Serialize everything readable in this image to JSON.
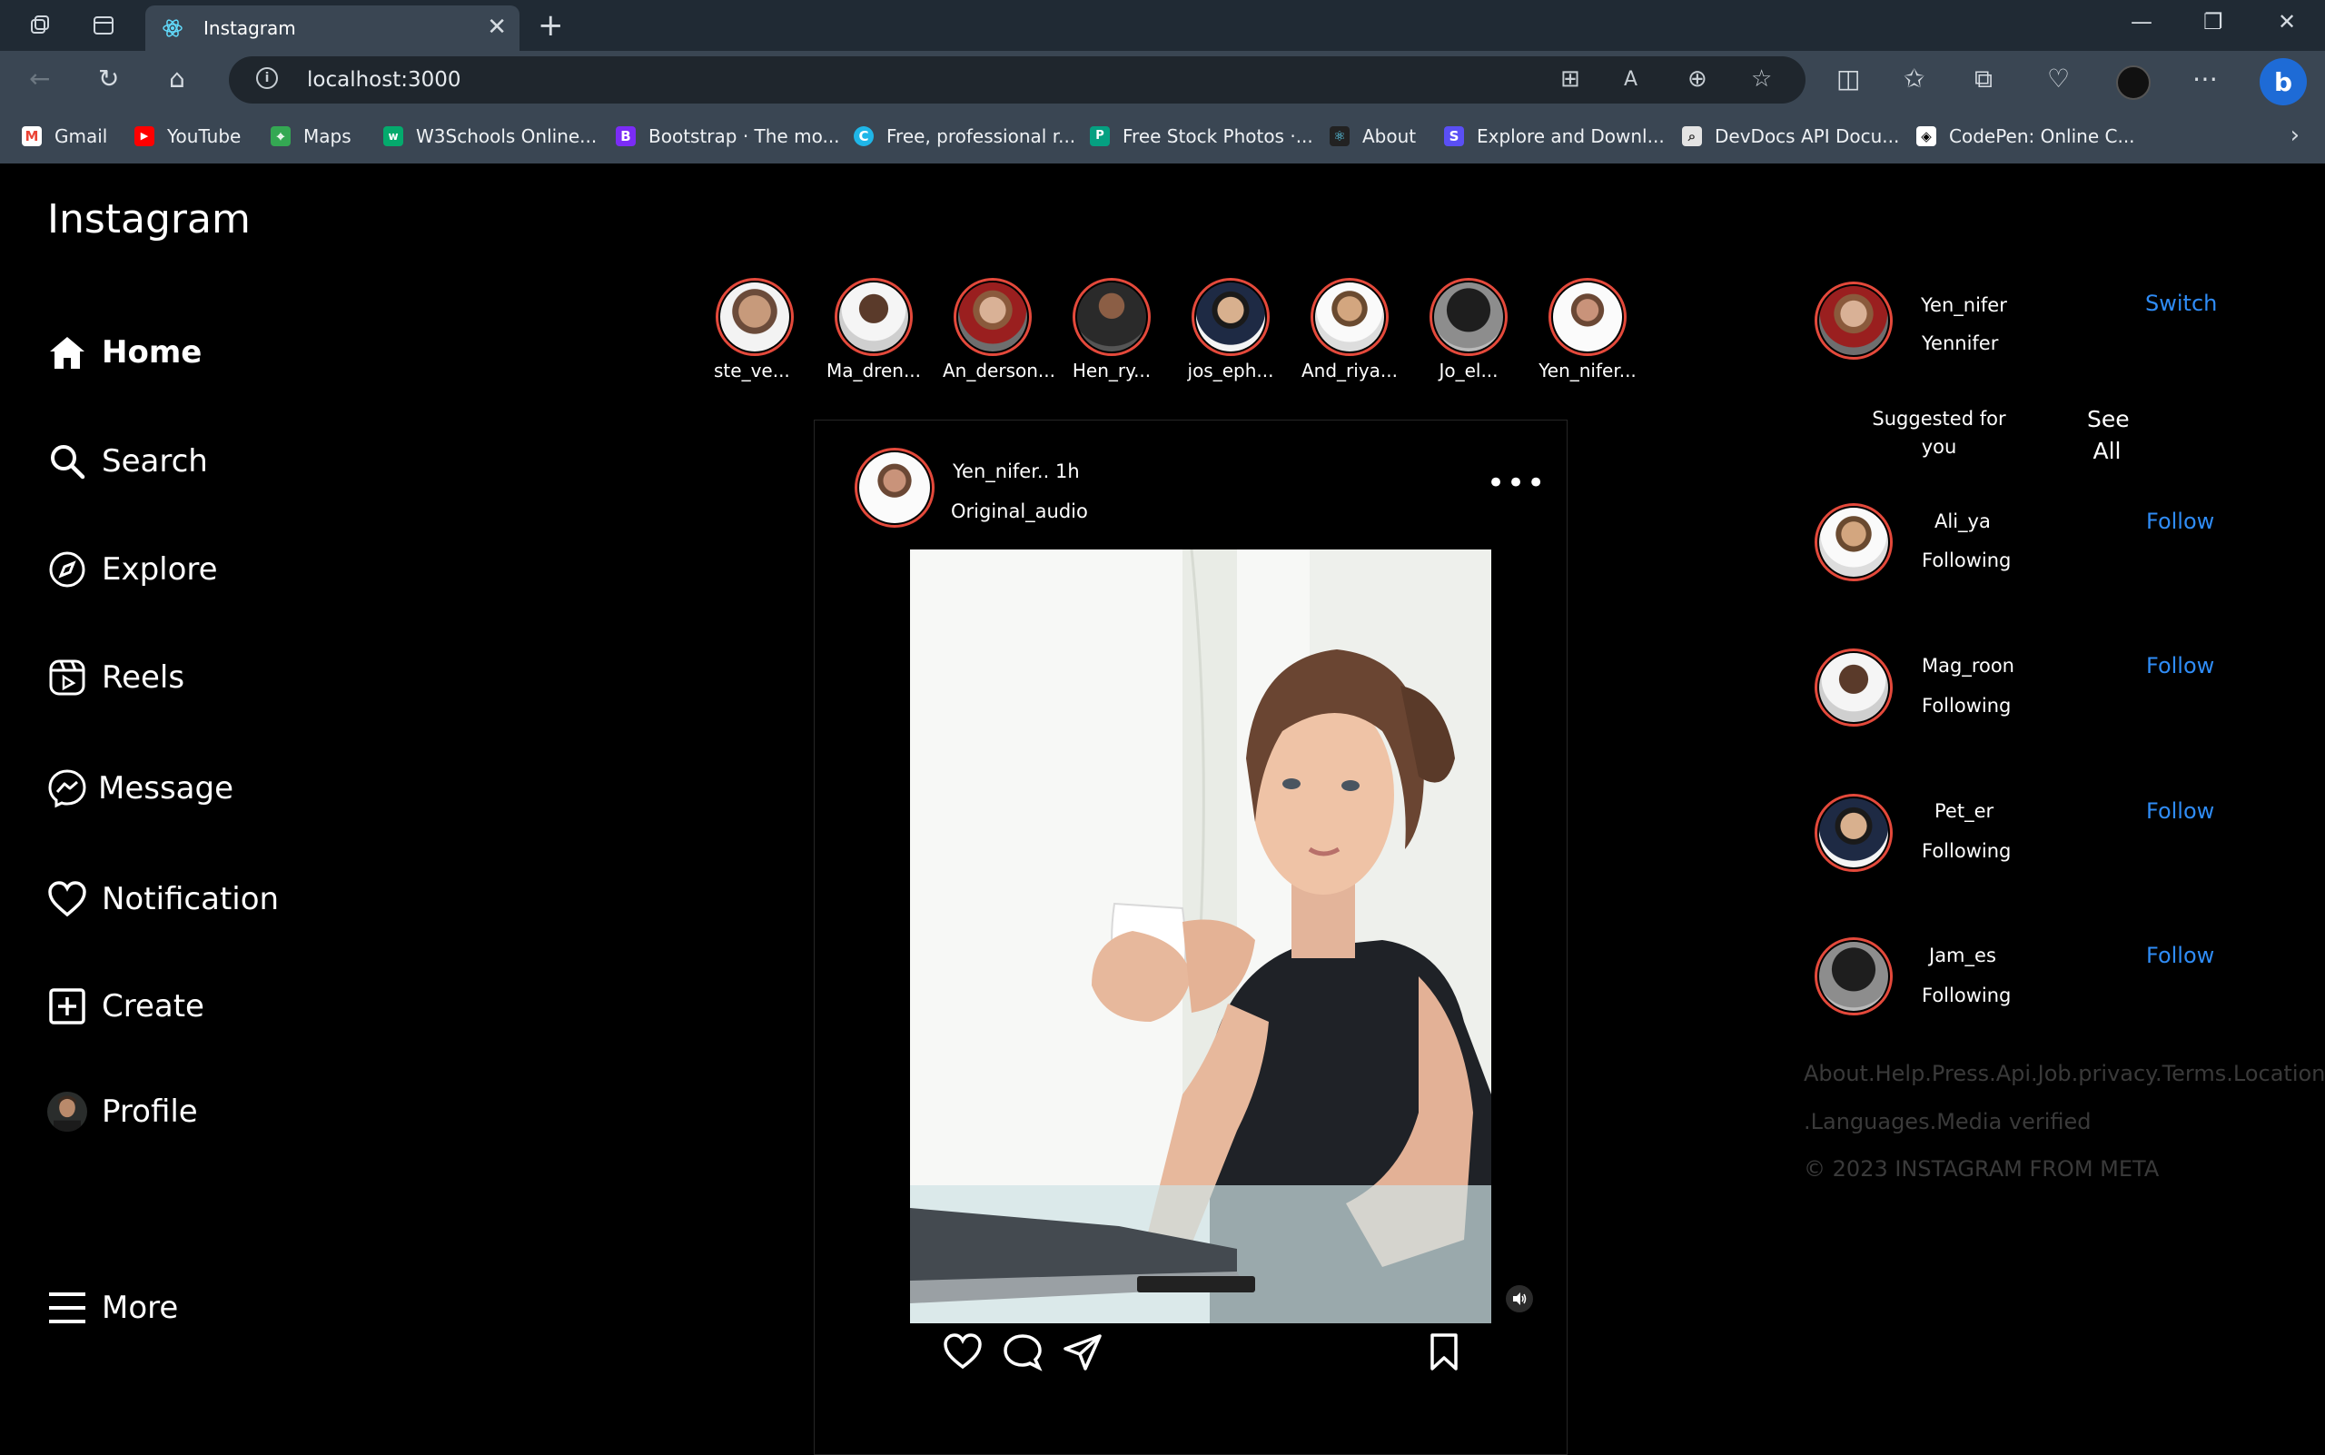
{
  "browser": {
    "tab_title": "Instagram",
    "url": "localhost:3000",
    "bookmarks": [
      {
        "label": "Gmail",
        "icon": "gmail-icon"
      },
      {
        "label": "YouTube",
        "icon": "youtube-icon"
      },
      {
        "label": "Maps",
        "icon": "maps-icon"
      },
      {
        "label": "W3Schools Online...",
        "icon": "w3schools-icon"
      },
      {
        "label": "Bootstrap · The mo...",
        "icon": "bootstrap-icon"
      },
      {
        "label": "Free, professional r...",
        "icon": "canva-icon"
      },
      {
        "label": "Free Stock Photos ·...",
        "icon": "pexels-icon"
      },
      {
        "label": "About",
        "icon": "react-icon"
      },
      {
        "label": "Explore and Downl...",
        "icon": "explore-icon"
      },
      {
        "label": "DevDocs API Docu...",
        "icon": "devdocs-icon"
      },
      {
        "label": "CodePen: Online C...",
        "icon": "codepen-icon"
      }
    ]
  },
  "app": {
    "logo": "Instagram",
    "nav": [
      {
        "label": "Home",
        "icon": "home-icon",
        "active": true
      },
      {
        "label": "Search",
        "icon": "search-icon"
      },
      {
        "label": "Explore",
        "icon": "compass-icon"
      },
      {
        "label": "Reels",
        "icon": "reels-icon"
      },
      {
        "label": "Message",
        "icon": "messenger-icon"
      },
      {
        "label": "Notification",
        "icon": "heart-icon"
      },
      {
        "label": "Create",
        "icon": "plus-square-icon"
      },
      {
        "label": "Profile",
        "icon": "profile-avatar"
      }
    ],
    "more": "More",
    "stories": [
      "ste_ve...",
      "Ma_dren...",
      "An_derson...",
      "Hen_ry...",
      "jos_eph...",
      "And_riya...",
      "Jo_el...",
      "Yen_nifer..."
    ],
    "post": {
      "user_line": "Yen_nifer.. 1h",
      "audio": "Original_audio",
      "more_icon": "more-dots-icon"
    },
    "sidebar": {
      "username": "Yen_nifer",
      "fullname": "Yennifer",
      "switch": "Switch",
      "suggested": "Suggested for you",
      "see_all": "See All",
      "suggestions": [
        {
          "name": "Ali_ya",
          "status": "Following",
          "action": "Follow"
        },
        {
          "name": "Mag_roon",
          "status": "Following",
          "action": "Follow"
        },
        {
          "name": "Pet_er",
          "status": "Following",
          "action": "Follow"
        },
        {
          "name": "Jam_es",
          "status": "Following",
          "action": "Follow"
        }
      ],
      "footer_line1": "About.Help.Press.Api.Job.privacy.Terms.Location",
      "footer_line2": ".Languages.Media verified",
      "copyright": "© 2023 INSTAGRAM FROM META"
    }
  }
}
